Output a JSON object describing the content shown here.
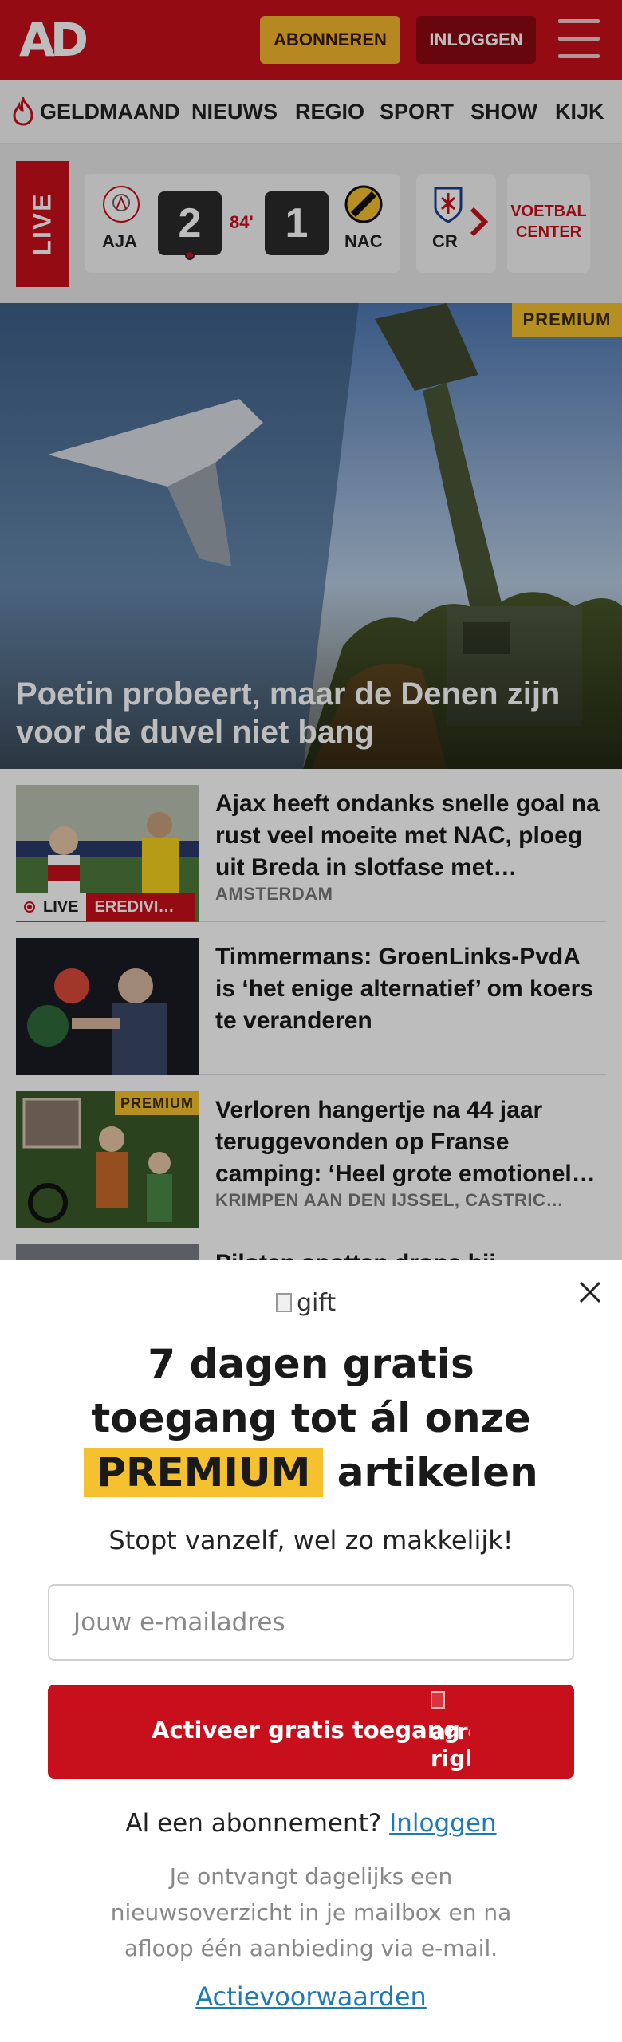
{
  "header": {
    "logo": "AD",
    "subscribe_label": "ABONNEREN",
    "login_label": "INLOGGEN",
    "colors": {
      "brand": "#c8101c",
      "subscribe": "#f5b82e",
      "login": "#8b0a12"
    }
  },
  "nav": {
    "items": [
      "GELDMAAND",
      "NIEUWS",
      "REGIO",
      "SPORT",
      "SHOW",
      "KIJK"
    ]
  },
  "live": {
    "label": "LIVE",
    "match": {
      "home": "AJA",
      "home_score": "2",
      "minute": "84'",
      "away_score": "1",
      "away": "NAC"
    },
    "next_match_team": "CR",
    "voetbal_center": "VOETBAL CENTER"
  },
  "hero": {
    "badge": "PREMIUM",
    "title": "Poetin probeert, maar de Denen zijn voor de duvel niet bang"
  },
  "articles": [
    {
      "title": "Ajax heeft ondanks snelle goal na rust veel moeite met NAC, ploeg uit Breda in slotfase met…",
      "location": "AMSTERDAM",
      "live_label": "LIVE",
      "category": "EREDIVI…"
    },
    {
      "title": "Timmermans: GroenLinks-PvdA is ‘het enige alternatief’ om koers te veranderen"
    },
    {
      "title": "Verloren hangertje na 44 jaar teruggevonden op Franse camping: ‘Heel grote emotionel…",
      "location": "KRIMPEN AAN DEN IJSSEL, CASTRIC…",
      "badge": "PREMIUM"
    },
    {
      "title": "Piloten spotten drone bij"
    }
  ],
  "modal": {
    "gift_alt": "gift",
    "headline_line1": "7 dagen gratis",
    "headline_line2": "toegang tot ál onze",
    "headline_premium": "PREMIUM",
    "headline_tail": "artikelen",
    "subline": "Stopt vanzelf, wel zo makkelijk!",
    "email_placeholder": "Jouw e-mailadres",
    "cta_label": "Activeer gratis toegang",
    "cta_icon_alt_1": "arro",
    "cta_icon_alt_2": "righ",
    "already_text": "Al een abonnement?",
    "already_link": "Inloggen",
    "note": "Je ontvangt dagelijks een nieuwsoverzicht in je mailbox en na afloop één aanbieding via e-mail.",
    "terms": "Actievoorwaarden",
    "colors": {
      "premium": "#f5c12e",
      "link": "#1e79b4",
      "cta": "#c8101c"
    }
  }
}
